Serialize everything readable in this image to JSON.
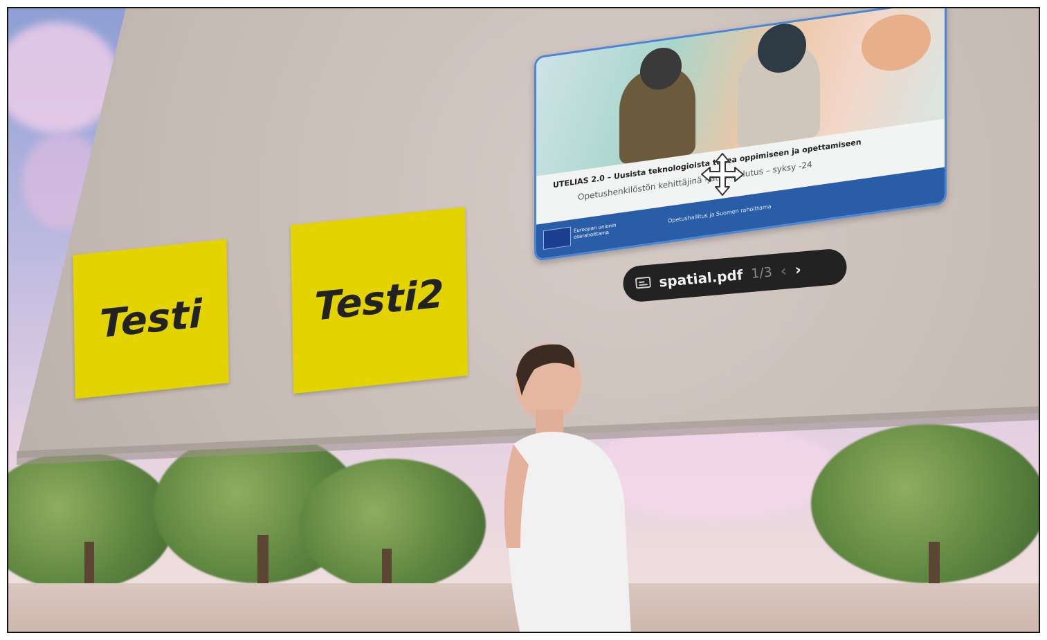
{
  "notes": [
    {
      "text": "Testi",
      "color": "#e3d300"
    },
    {
      "text": "Testi2",
      "color": "#e3d300"
    }
  ],
  "pdf_viewer": {
    "file_name": "spatial.pdf",
    "page_indicator": "1/3",
    "prev_label": "‹",
    "next_label": "›",
    "doc_heading": "UTELIAS 2.0 – Uusista teknologioista tukea oppimiseen ja opettamiseen",
    "doc_subtitle": "Opetushenkilöstön kehittäjinä -jatkokoulutus – syksy -24",
    "footer_text": "Opetushallitus ja Suomen rahoittama",
    "eu_text": "Euroopan unionin osarahoittama",
    "accent_color": "#4a86d6"
  },
  "icons": {
    "move": "move-arrows-icon",
    "document": "presentation-icon"
  }
}
